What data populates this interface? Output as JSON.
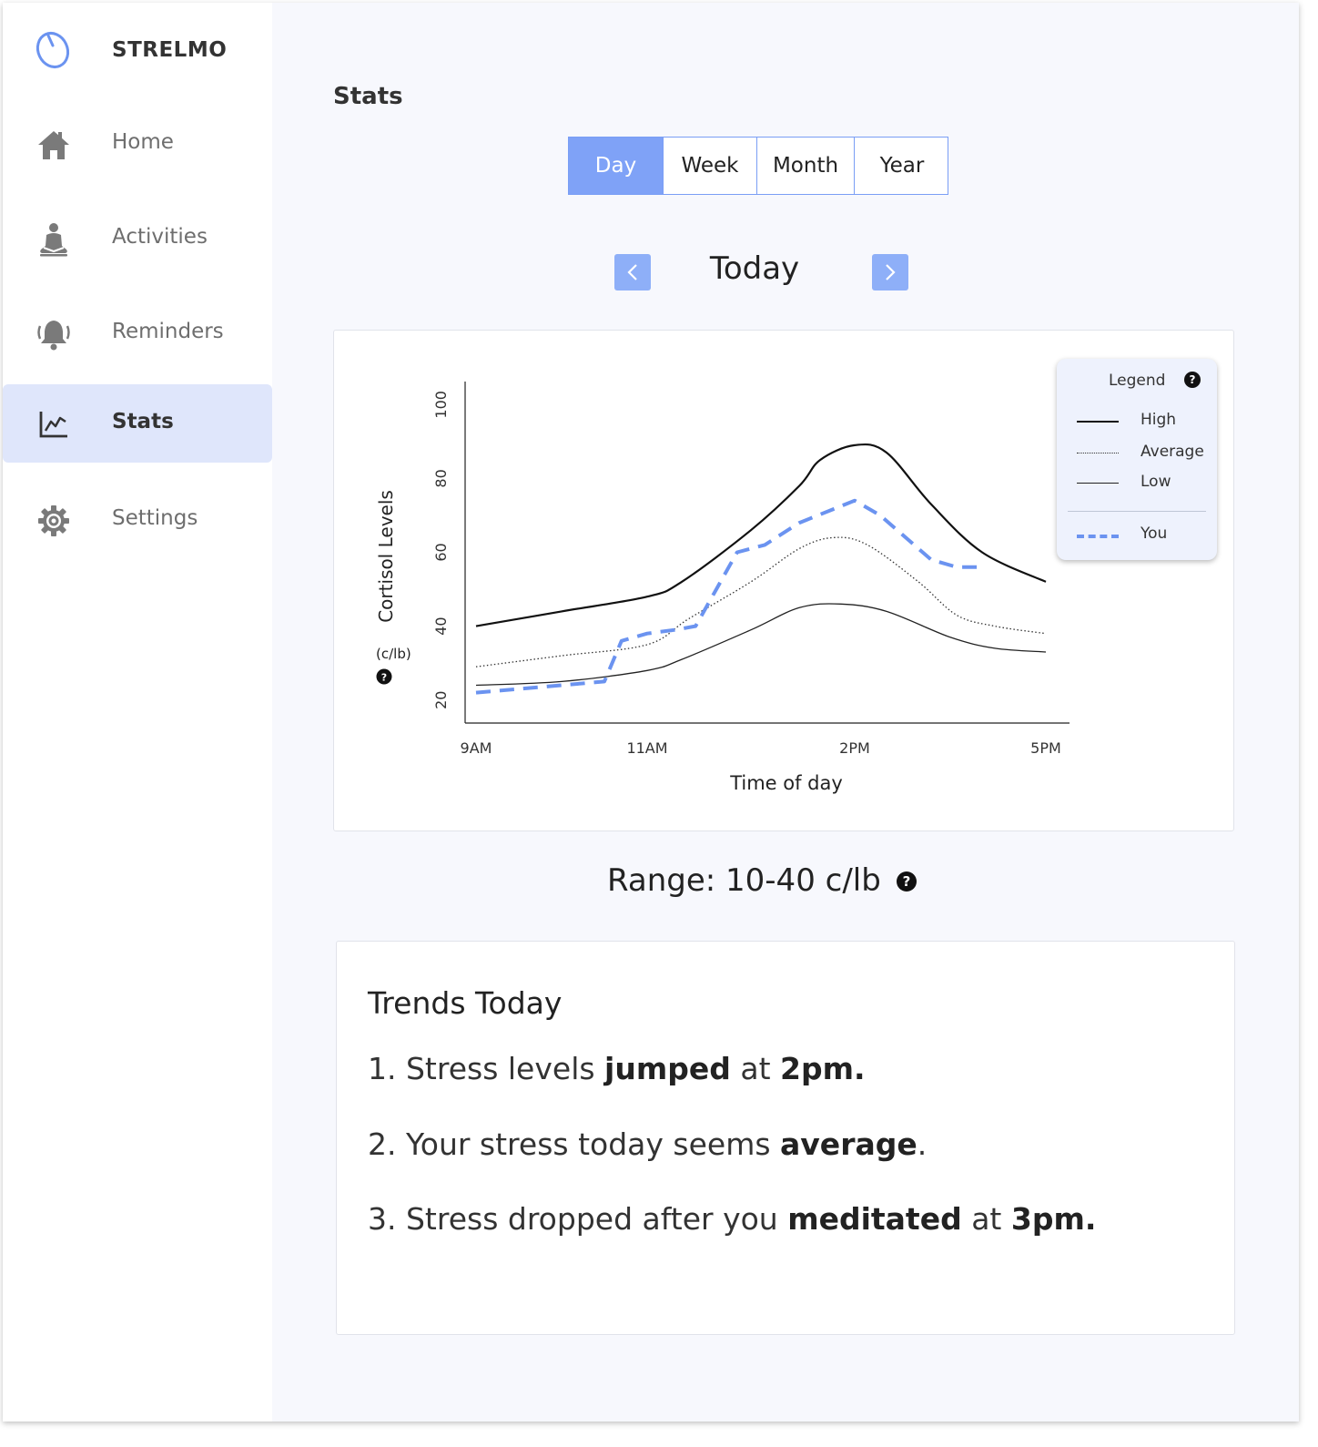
{
  "app": {
    "name": "STRELMO"
  },
  "sidebar": {
    "items": [
      {
        "label": "Home",
        "icon": "home-icon"
      },
      {
        "label": "Activities",
        "icon": "meditation-icon"
      },
      {
        "label": "Reminders",
        "icon": "bell-icon"
      },
      {
        "label": "Stats",
        "icon": "chart-icon",
        "active": true
      },
      {
        "label": "Settings",
        "icon": "gear-icon"
      }
    ]
  },
  "page": {
    "title": "Stats"
  },
  "period_tabs": {
    "items": [
      "Day",
      "Week",
      "Month",
      "Year"
    ],
    "active": "Day"
  },
  "period_nav": {
    "label": "Today",
    "prev_icon": "chevron-left-icon",
    "next_icon": "chevron-right-icon"
  },
  "chart_data": {
    "type": "line",
    "ylabel": "Cortisol Levels",
    "yunit": "(c/lb)",
    "xlabel": "Time of day",
    "xticks": [
      "9AM",
      "11AM",
      "2PM",
      "5PM"
    ],
    "yticks": [
      "20",
      "40",
      "60",
      "80",
      "100"
    ],
    "ylim": [
      15,
      105
    ],
    "legend_title": "Legend",
    "legend_position": "top-right",
    "series": [
      {
        "name": "High",
        "style": "solid-thick",
        "color": "#111111",
        "x": [
          9.0,
          10.0,
          11.0,
          11.5,
          12.5,
          13.2,
          13.5,
          14.0,
          14.5,
          15.2,
          16.0,
          17.0
        ],
        "values": [
          40,
          44,
          48,
          52,
          66,
          78,
          85,
          89,
          87,
          73,
          60,
          52
        ]
      },
      {
        "name": "Average",
        "style": "dotted",
        "color": "#333333",
        "x": [
          9.0,
          10.0,
          11.0,
          11.6,
          12.5,
          13.2,
          13.7,
          14.2,
          15.0,
          15.6,
          16.2,
          17.0
        ],
        "values": [
          29,
          32,
          35,
          42,
          52,
          61,
          64,
          62,
          52,
          43,
          40,
          38
        ]
      },
      {
        "name": "Low",
        "style": "solid-thin",
        "color": "#222222",
        "x": [
          9.0,
          10.0,
          11.0,
          11.5,
          12.5,
          13.2,
          13.8,
          14.5,
          15.5,
          16.2,
          17.0
        ],
        "values": [
          24,
          25,
          28,
          31,
          39,
          45,
          46,
          44,
          37,
          34,
          33
        ]
      },
      {
        "name": "You",
        "style": "dashed",
        "color": "#6b93f0",
        "x": [
          9.0,
          10.0,
          10.5,
          10.7,
          11.0,
          11.4,
          11.7,
          12.0,
          12.3,
          12.7,
          13.2,
          14.0,
          14.4,
          14.8,
          15.2,
          15.6,
          16.0
        ],
        "values": [
          22,
          24,
          25,
          36,
          38,
          39,
          40,
          50,
          60,
          62,
          68,
          74,
          70,
          64,
          58,
          56,
          56
        ]
      }
    ]
  },
  "range": {
    "label": "Range: 10-40 c/lb"
  },
  "trends": {
    "title": "Trends Today",
    "items": [
      {
        "num": "1.",
        "parts": [
          {
            "t": "Stress levels "
          },
          {
            "t": "jumped",
            "b": true
          },
          {
            "t": " at "
          },
          {
            "t": "2pm.",
            "b": true
          }
        ]
      },
      {
        "num": "2.",
        "parts": [
          {
            "t": "Your stress today seems "
          },
          {
            "t": "average",
            "b": true
          },
          {
            "t": "."
          }
        ]
      },
      {
        "num": "3.",
        "parts": [
          {
            "t": "Stress dropped after you "
          },
          {
            "t": "meditated",
            "b": true
          },
          {
            "t": " at "
          },
          {
            "t": "3pm.",
            "b": true
          }
        ]
      }
    ]
  },
  "colors": {
    "accent": "#7fa2f7",
    "active_nav_bg": "#dfe6fb",
    "you_line": "#6b93f0"
  }
}
